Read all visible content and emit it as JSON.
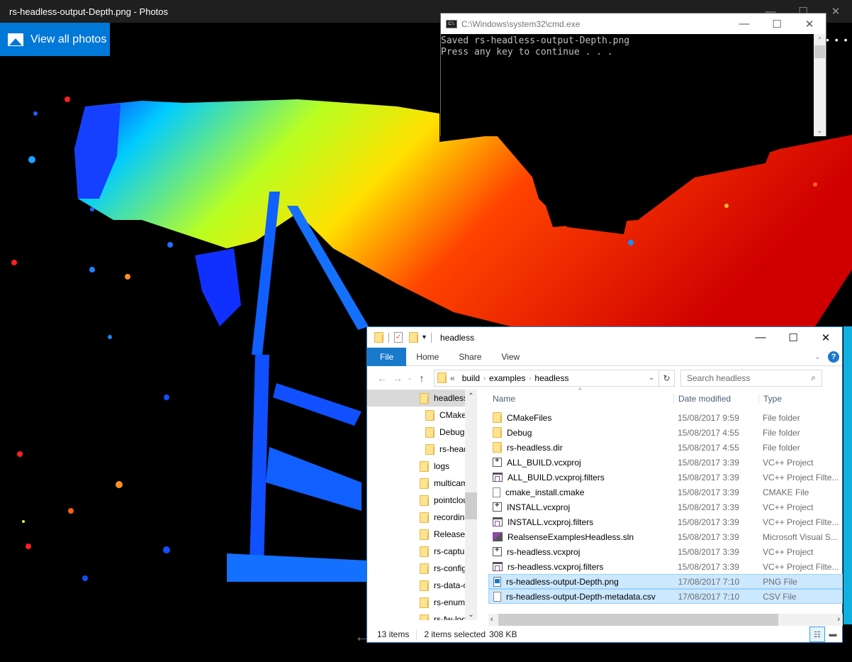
{
  "photos": {
    "window_title": "rs-headless-output-Depth.png - Photos",
    "view_all_label": "View all photos",
    "more_label": "• • •",
    "prev_label": "←",
    "controls": {
      "minimize": "—",
      "maximize": "☐",
      "close": "✕"
    }
  },
  "cmd": {
    "title": "C:\\Windows\\system32\\cmd.exe",
    "icon_label": "C:\\.",
    "lines": [
      "Saved rs-headless-output-Depth.png",
      "Press any key to continue . . ."
    ],
    "controls": {
      "minimize": "—",
      "maximize": "☐",
      "close": "✕"
    },
    "scroll_up": "⌃",
    "scroll_down": "⌄"
  },
  "explorer": {
    "title": "headless",
    "controls": {
      "minimize": "—",
      "maximize": "☐",
      "close": "✕"
    },
    "ribbon_tabs": [
      "File",
      "Home",
      "Share",
      "View"
    ],
    "expand_ribbon": "⌄",
    "help": "?",
    "nav": {
      "back": "←",
      "forward": "→",
      "recent": "⌄",
      "up": "↑"
    },
    "address": {
      "overflow": "«",
      "crumbs": [
        "build",
        "examples",
        "headless"
      ],
      "separator": "›",
      "dropdown": "⌄",
      "refresh": "↻"
    },
    "search_placeholder": "Search headless",
    "search_icon": "⌕",
    "nav_pane": [
      {
        "label": "headless",
        "selected": true,
        "indent": 1
      },
      {
        "label": "CMakeFiles",
        "indent": 2
      },
      {
        "label": "Debug",
        "indent": 2
      },
      {
        "label": "rs-headless.dir",
        "indent": 2
      },
      {
        "label": "logs",
        "indent": 1
      },
      {
        "label": "multicam",
        "indent": 1
      },
      {
        "label": "pointcloud",
        "indent": 1
      },
      {
        "label": "recording",
        "indent": 1
      },
      {
        "label": "Release",
        "indent": 1
      },
      {
        "label": "rs-capture",
        "indent": 1
      },
      {
        "label": "rs-config",
        "indent": 1
      },
      {
        "label": "rs-data-collect",
        "indent": 1
      },
      {
        "label": "rs-enumerate",
        "indent": 1
      },
      {
        "label": "rs-fw-logger",
        "indent": 1
      }
    ],
    "columns": [
      "Name",
      "Date modified",
      "Type"
    ],
    "sort_indicator": "^",
    "files": [
      {
        "name": "CMakeFiles",
        "date": "15/08/2017 9:59",
        "type": "File folder",
        "icon": "folder"
      },
      {
        "name": "Debug",
        "date": "15/08/2017 4:55",
        "type": "File folder",
        "icon": "folder"
      },
      {
        "name": "rs-headless.dir",
        "date": "15/08/2017 4:55",
        "type": "File folder",
        "icon": "folder"
      },
      {
        "name": "ALL_BUILD.vcxproj",
        "date": "15/08/2017 3:39",
        "type": "VC++ Project",
        "icon": "vcxproj"
      },
      {
        "name": "ALL_BUILD.vcxproj.filters",
        "date": "15/08/2017 3:39",
        "type": "VC++ Project Filte...",
        "icon": "filters"
      },
      {
        "name": "cmake_install.cmake",
        "date": "15/08/2017 3:39",
        "type": "CMAKE File",
        "icon": "file"
      },
      {
        "name": "INSTALL.vcxproj",
        "date": "15/08/2017 3:39",
        "type": "VC++ Project",
        "icon": "vcxproj"
      },
      {
        "name": "INSTALL.vcxproj.filters",
        "date": "15/08/2017 3:39",
        "type": "VC++ Project Filte...",
        "icon": "filters"
      },
      {
        "name": "RealsenseExamplesHeadless.sln",
        "date": "15/08/2017 3:39",
        "type": "Microsoft Visual S...",
        "icon": "sln"
      },
      {
        "name": "rs-headless.vcxproj",
        "date": "15/08/2017 3:39",
        "type": "VC++ Project",
        "icon": "vcxproj"
      },
      {
        "name": "rs-headless.vcxproj.filters",
        "date": "15/08/2017 3:39",
        "type": "VC++ Project Filte...",
        "icon": "filters"
      },
      {
        "name": "rs-headless-output-Depth.png",
        "date": "17/08/2017 7:10",
        "type": "PNG File",
        "icon": "png",
        "selected": true
      },
      {
        "name": "rs-headless-output-Depth-metadata.csv",
        "date": "17/08/2017 7:10",
        "type": "CSV File",
        "icon": "file",
        "selected": true
      }
    ],
    "status": {
      "count": "13 items",
      "selected": "2 items selected",
      "size": "308 KB"
    },
    "scroll_left": "‹",
    "scroll_right": "›",
    "view_details": "☷",
    "view_tiles": "▬"
  }
}
